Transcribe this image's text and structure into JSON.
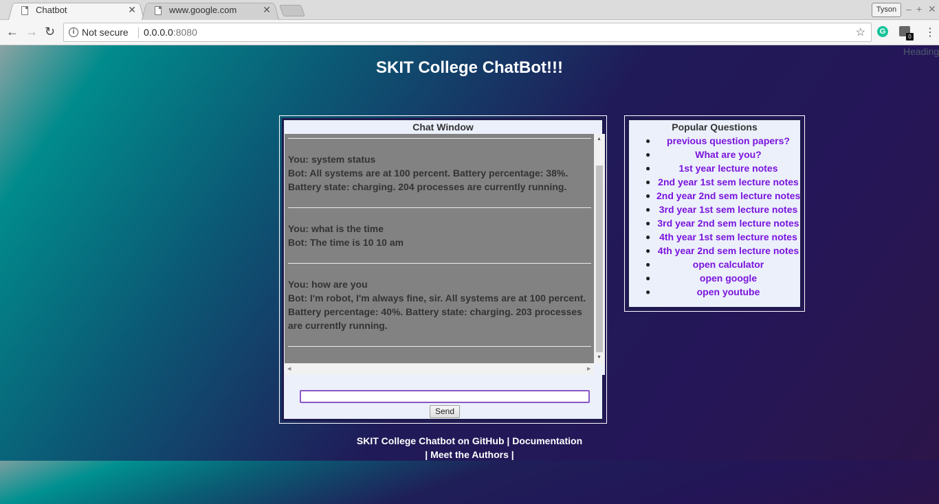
{
  "browser": {
    "tabs": [
      {
        "title": "Chatbot",
        "active": true
      },
      {
        "title": "www.google.com",
        "active": false
      }
    ],
    "profile_name": "Tyson",
    "security_label": "Not secure",
    "url_host": "0.0.0.0",
    "url_port": ":8080",
    "extension_badge": "0",
    "extension_g": "G"
  },
  "page": {
    "ghost_heading": "Heading",
    "title": "SKIT College ChatBot!!!",
    "chat": {
      "title": "Chat Window",
      "messages": [
        {
          "you": "You: system status",
          "bot": "Bot: All systems are at 100 percent. Battery percentage: 38%. Battery state: charging. 204 processes are currently running."
        },
        {
          "you": "You: what is the time",
          "bot": "Bot: The time is 10 10 am"
        },
        {
          "you": "You: how are you",
          "bot": "Bot: I'm robot, I'm always fine, sir. All systems are at 100 percent. Battery percentage: 40%. Battery state: charging. 203 processes are currently running."
        }
      ],
      "input_value": "",
      "send_label": "Send"
    },
    "popular": {
      "title": "Popular Questions",
      "items": [
        "previous question papers?",
        "What are you?",
        "1st year lecture notes",
        "2nd year 1st sem lecture notes",
        "2nd year 2nd sem lecture notes",
        "3rd year 1st sem lecture notes",
        "3rd year 2nd sem lecture notes",
        "4th year 1st sem lecture notes",
        "4th year 2nd sem lecture notes",
        "open calculator",
        "open google",
        "open youtube"
      ]
    },
    "footer": {
      "github": "SKIT College Chatbot on GitHub",
      "sep1": " | ",
      "docs": "Documentation",
      "sep2": "| ",
      "authors": "Meet the Authors",
      "sep3": " |"
    }
  },
  "colors": {
    "link": "#7a13dd",
    "panel_border": "#1e1a4b",
    "chat_bg": "#828282",
    "panel_bg": "#ebf0fb"
  }
}
